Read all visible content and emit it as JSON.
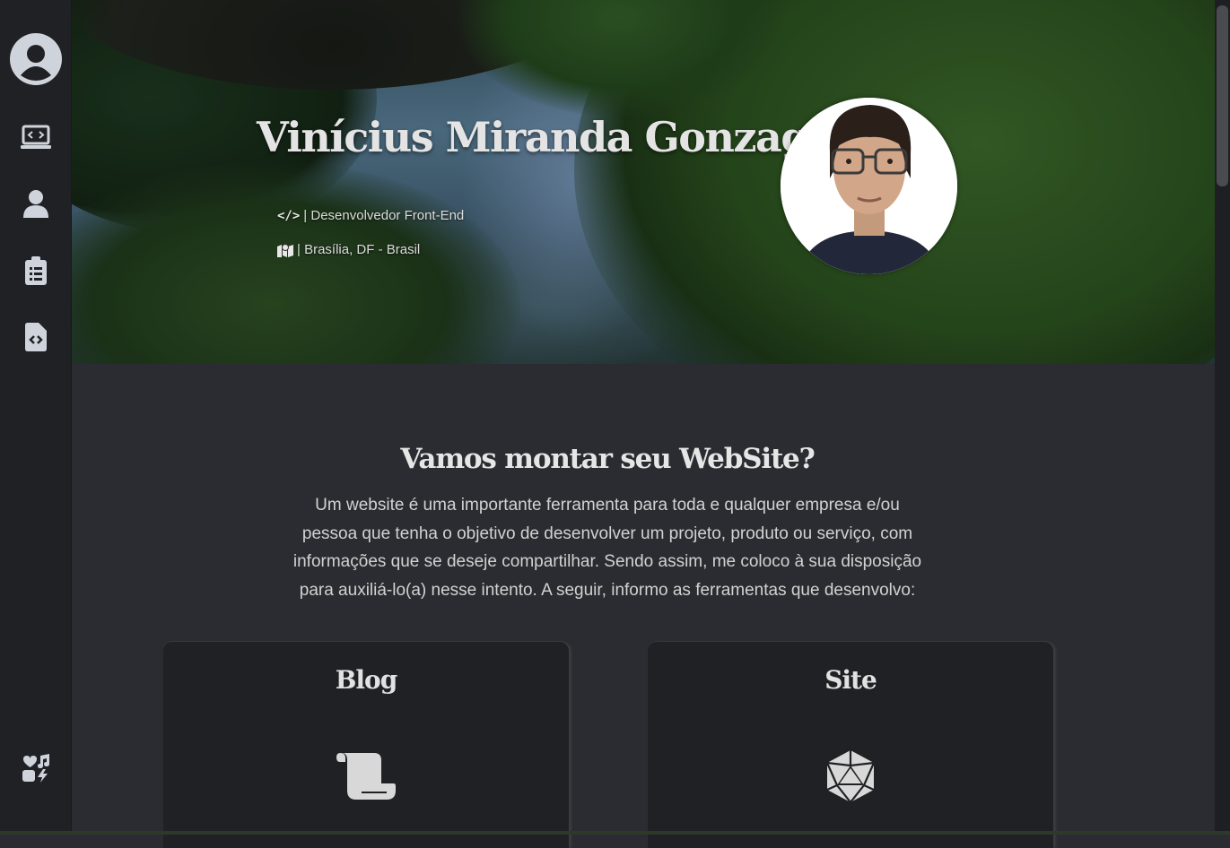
{
  "sidebar": {
    "items": [
      {
        "name": "profile-avatar-icon"
      },
      {
        "name": "laptop-code-icon"
      },
      {
        "name": "user-icon"
      },
      {
        "name": "clipboard-list-icon"
      },
      {
        "name": "file-code-icon"
      }
    ],
    "bottom_item": {
      "name": "icons-shapes-icon"
    }
  },
  "hero": {
    "name": "Vinícius Miranda Gonzaga",
    "role_icon": "</>",
    "role": "| Desenvolvedor Front-End",
    "location_icon": "map-location-icon",
    "location": "| Brasília, DF - Brasil"
  },
  "main": {
    "title": "Vamos montar seu WebSite?",
    "intro_lines": [
      "Um website é uma importante ferramenta para toda e qualquer empresa e/ou",
      "pessoa que tenha o objetivo de desenvolver um projeto, produto ou serviço, com",
      "informações que se deseje compartilhar. Sendo assim, me coloco à sua disposição",
      "para auxiliá-lo(a) nesse intento. A seguir, informo as ferramentas que desenvolvo:"
    ]
  },
  "cards": [
    {
      "title": "Blog",
      "icon": "scroll-icon"
    },
    {
      "title": "Site",
      "icon": "d20-dice-icon"
    }
  ],
  "colors": {
    "page_bg": "#2b2c31",
    "sidebar_bg": "#202125",
    "card_bg": "#202125",
    "icon": "#cfd4dc",
    "text": "#d2d2d2"
  }
}
